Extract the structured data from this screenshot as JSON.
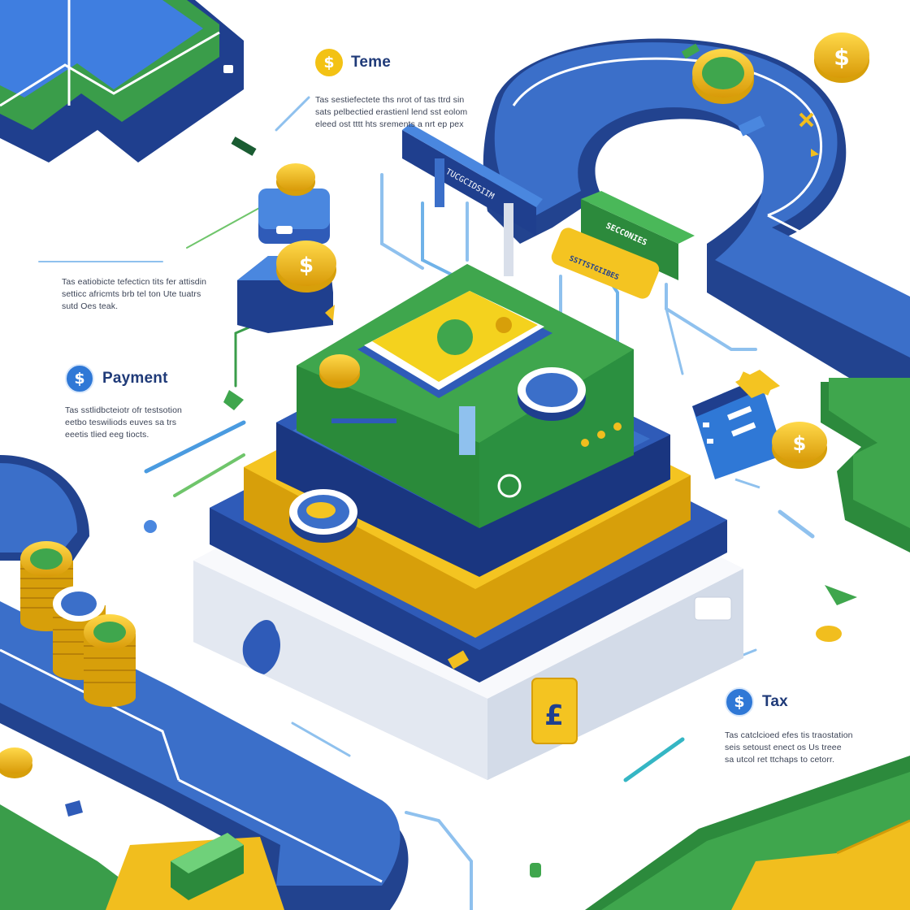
{
  "callouts": {
    "teme": {
      "title": "Teme",
      "icon": "dollar-coin-icon",
      "lines": [
        "Tas sestiefectete ths nrot of tas ttrd sin",
        "sats pelbectied erastienl lend sst eolom",
        "eleed ost tttt hts srements a nrt ep pex"
      ]
    },
    "left_note": {
      "lines": [
        "Tas eatiobicte tefecticn tits fer attisdin",
        "setticc africmts brb tel ton Ute tuatrs",
        "sutd Oes teak."
      ]
    },
    "payment": {
      "title": "Payment",
      "icon": "dollar-coin-icon",
      "lines": [
        "Tas sstlidbcteiotr ofr testsotion",
        "eetbo teswiliods euves sa trs",
        "eeetis tlied eeg tiocts."
      ]
    },
    "tax": {
      "title": "Tax",
      "icon": "dollar-coin-icon",
      "lines": [
        "Tas catclcioed efes tis traostation",
        "seis setoust enect os Us treee",
        "sa utcol ret ttchaps to cetorr."
      ]
    }
  },
  "signs": {
    "top_sign": "TUCGCIDSIIM",
    "green_sign": "SECCONIES",
    "yellow_sign": "SSTTSTGIIBES"
  },
  "colors": {
    "navy": "#22438f",
    "blue": "#3b6fc9",
    "green": "#3a9d4a",
    "yellow": "#f1be1e",
    "light_blue": "#8fc1ee",
    "gray": "#e7ebf3"
  }
}
